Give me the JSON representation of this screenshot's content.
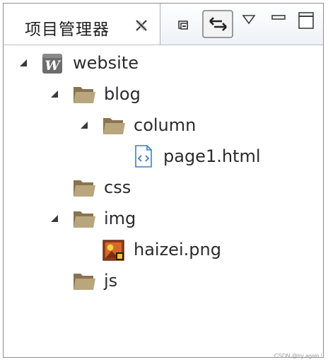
{
  "panel": {
    "title": "项目管理器",
    "close_icon": "close-x-icon",
    "toolbar": [
      "collapse-all-icon",
      "link-with-editor-icon",
      "view-menu-icon",
      "minimize-icon",
      "maximize-icon"
    ]
  },
  "tree": [
    {
      "label": "website",
      "kind": "project",
      "expanded": true
    },
    {
      "label": "blog",
      "kind": "folder",
      "expanded": true
    },
    {
      "label": "column",
      "kind": "folder",
      "expanded": true
    },
    {
      "label": "page1.html",
      "kind": "html-file"
    },
    {
      "label": "css",
      "kind": "folder"
    },
    {
      "label": "img",
      "kind": "folder",
      "expanded": true
    },
    {
      "label": "haizei.png",
      "kind": "image-file"
    },
    {
      "label": "js",
      "kind": "folder"
    }
  ],
  "watermark": "CSDN @try again !"
}
